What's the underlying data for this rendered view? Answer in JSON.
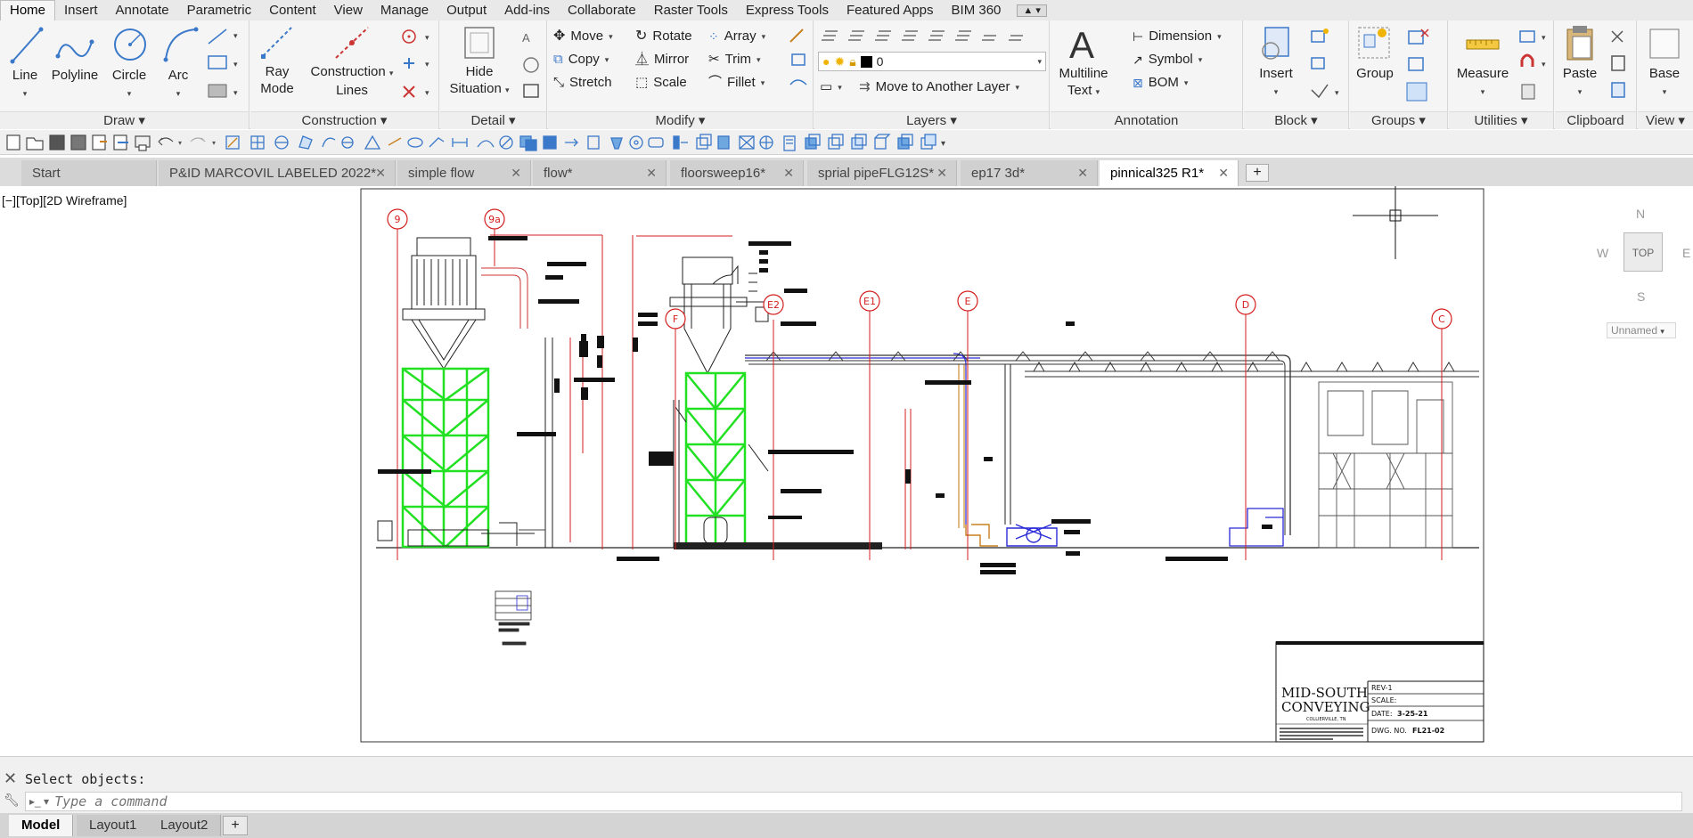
{
  "menu": {
    "tabs": [
      "Home",
      "Insert",
      "Annotate",
      "Parametric",
      "Content",
      "View",
      "Manage",
      "Output",
      "Add-ins",
      "Collaborate",
      "Raster Tools",
      "Express Tools",
      "Featured Apps",
      "BIM 360"
    ],
    "active": "Home"
  },
  "ribbon": {
    "draw": {
      "title": "Draw",
      "line": "Line",
      "polyline": "Polyline",
      "circle": "Circle",
      "arc": "Arc"
    },
    "construction": {
      "title": "Construction",
      "ray_mode_1": "Ray",
      "ray_mode_2": "Mode",
      "construction_lines_1": "Construction",
      "construction_lines_2": "Lines"
    },
    "detail": {
      "title": "Detail",
      "hide_situation_1": "Hide",
      "hide_situation_2": "Situation"
    },
    "modify": {
      "title": "Modify",
      "move": "Move",
      "rotate": "Rotate",
      "array": "Array",
      "copy": "Copy",
      "mirror": "Mirror",
      "trim": "Trim",
      "stretch": "Stretch",
      "scale": "Scale",
      "fillet": "Fillet"
    },
    "layers": {
      "title": "Layers",
      "current_layer": "0",
      "move_to_layer": "Move to Another Layer"
    },
    "annotation": {
      "title": "Annotation",
      "multiline_text_1": "Multiline",
      "multiline_text_2": "Text",
      "dimension": "Dimension",
      "symbol": "Symbol",
      "bom": "BOM"
    },
    "block": {
      "title": "Block",
      "insert": "Insert"
    },
    "groups": {
      "title": "Groups",
      "group": "Group"
    },
    "utilities": {
      "title": "Utilities",
      "measure": "Measure"
    },
    "clipboard": {
      "title": "Clipboard",
      "paste": "Paste"
    },
    "view": {
      "title": "View",
      "base": "Base"
    }
  },
  "file_tabs": [
    {
      "label": "Start"
    },
    {
      "label": "P&ID MARCOVIL LABELED 2022*"
    },
    {
      "label": "simple flow"
    },
    {
      "label": "flow*"
    },
    {
      "label": "floorsweep16*"
    },
    {
      "label": "sprial pipeFLG12S*"
    },
    {
      "label": "ep17 3d*"
    },
    {
      "label": "pinnical325 R1*"
    }
  ],
  "viewport": {
    "label": "[−][Top][2D Wireframe]",
    "viewcube": {
      "n": "N",
      "s": "S",
      "w": "W",
      "e": "E",
      "face": "TOP"
    },
    "ucs": "Unnamed"
  },
  "drawing": {
    "markers": [
      "9",
      "9a",
      "F",
      "E2",
      "E1",
      "E",
      "D",
      "C"
    ],
    "title_block": {
      "company_1": "MID-SOUTH",
      "company_2": "CONVEYING",
      "city": "COLLIERVILLE, TN",
      "rev": "REV-1",
      "scale": "SCALE:",
      "date_label": "DATE:",
      "date": "3-25-21",
      "dwg_label": "DWG. NO.",
      "dwg": "FL21-02"
    }
  },
  "command": {
    "history": "Select objects:",
    "placeholder": "Type a command"
  },
  "layout_tabs": [
    "Model",
    "Layout1",
    "Layout2"
  ],
  "colors": {
    "structure": "#22e022",
    "markers": "#d41f1f",
    "duct": "#2a2ad8",
    "accent": "#c8801e"
  }
}
